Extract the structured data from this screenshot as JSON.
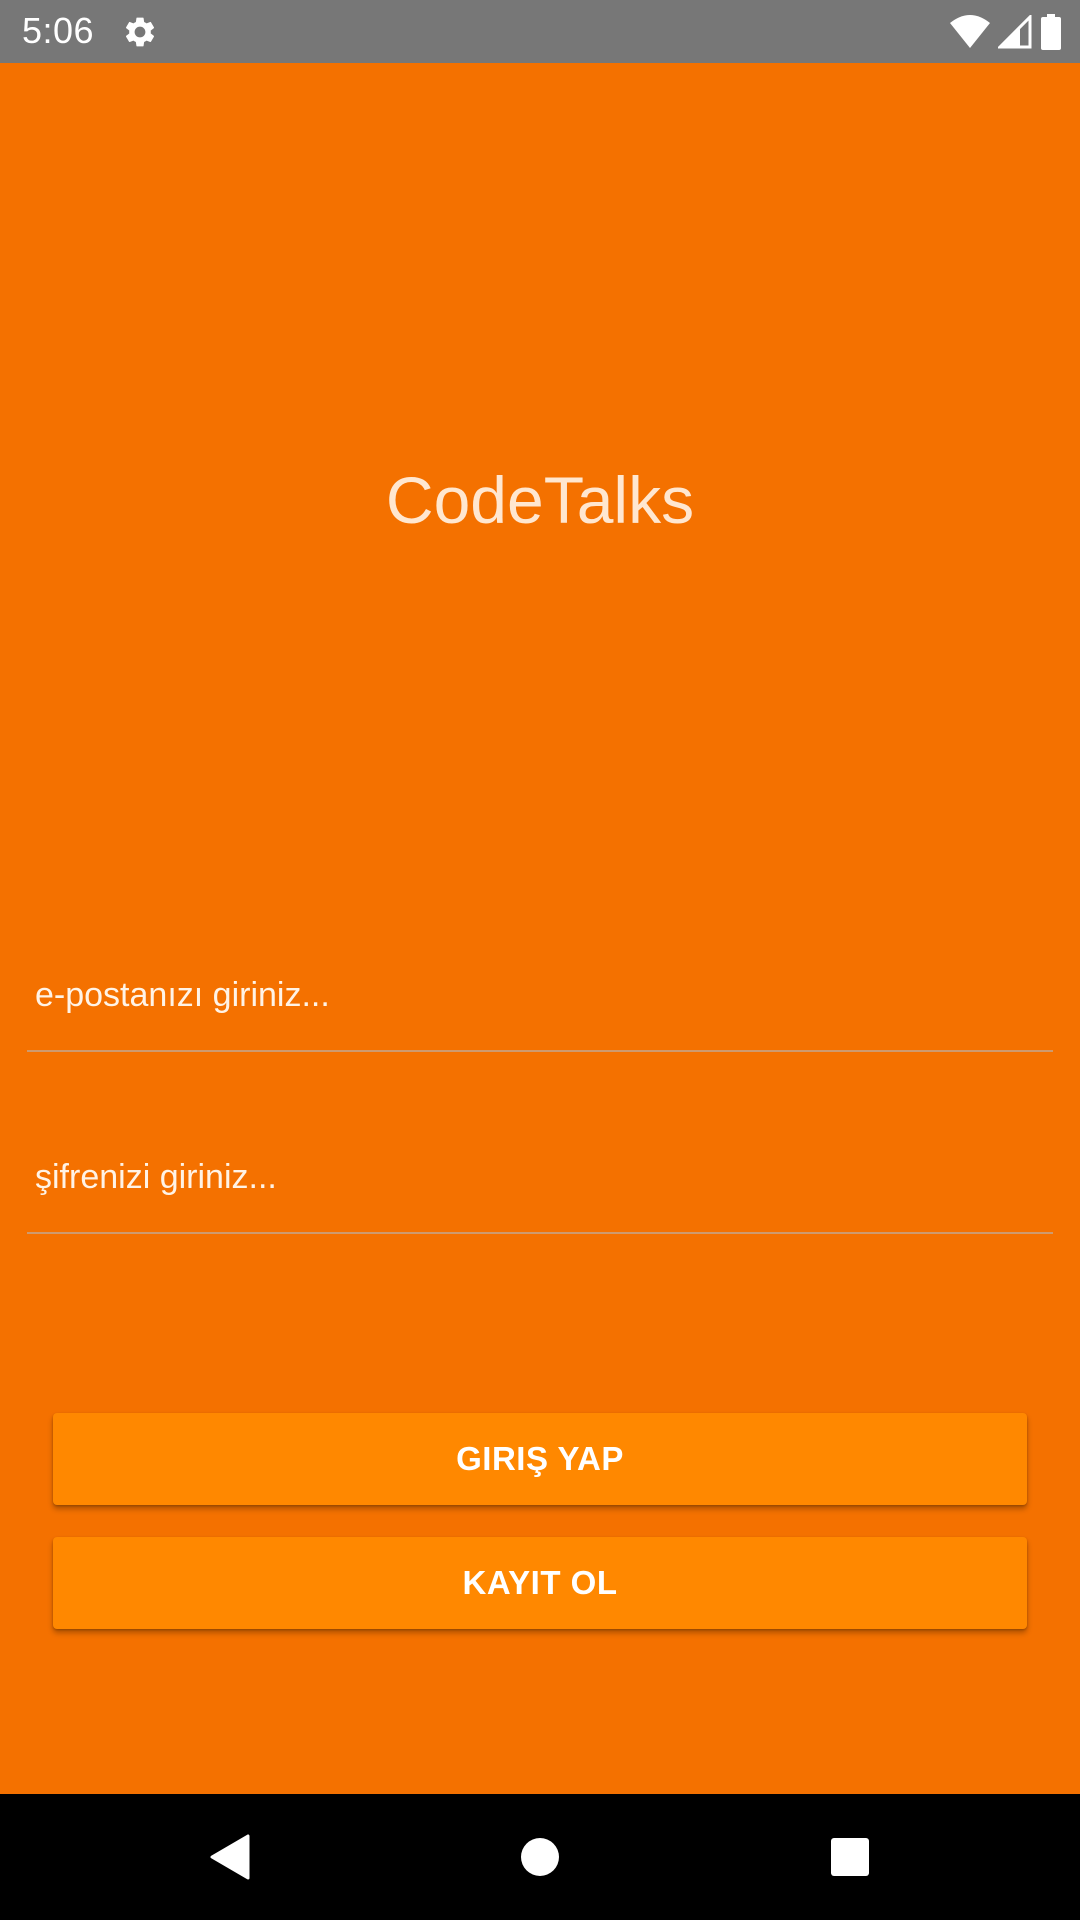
{
  "status_bar": {
    "time": "5:06",
    "icons": [
      "gear-icon",
      "wifi-icon",
      "signal-icon",
      "battery-icon"
    ]
  },
  "app": {
    "title": "CodeTalks"
  },
  "login_form": {
    "email": {
      "value": "",
      "placeholder": "e-postanızı giriniz..."
    },
    "password": {
      "value": "",
      "placeholder": "şifrenizi giriniz..."
    },
    "login_label": "GIRIŞ YAP",
    "register_label": "KAYIT OL"
  },
  "nav_bar": {
    "icons": [
      "back-icon",
      "home-icon",
      "recents-icon"
    ]
  },
  "colors": {
    "background": "#f47100",
    "button": "#ff8800",
    "status_bar": "#777777",
    "nav_bar": "#000000",
    "title_text": "#ffe7d0"
  }
}
